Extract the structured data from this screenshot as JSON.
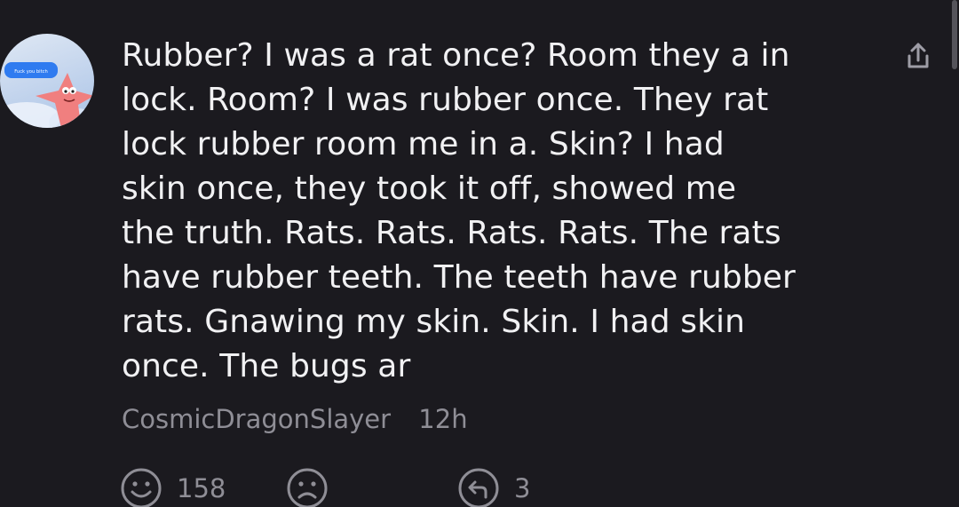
{
  "comment": {
    "avatar_text": "Fuck you bitch",
    "lines": [
      "Rubber? I was a rat once? Room they a in",
      "lock. Room? I was rubber once. They rat",
      "lock rubber room me in a. Skin? I had",
      "skin once, they took it off, showed me",
      "the truth. Rats. Rats. Rats. Rats. The rats",
      "have rubber teeth. The teeth have rubber",
      "rats. Gnawing my skin. Skin. I had skin",
      "once. The bugs ar"
    ],
    "author": "CosmicDragonSlayer",
    "time": "12h"
  },
  "actions": {
    "like_icon": "smiley-face-icon",
    "like_count": "158",
    "dislike_icon": "sad-face-icon",
    "reply_icon": "reply-icon",
    "reply_count": "3",
    "share_icon": "share-icon"
  },
  "colors": {
    "background": "#1b1a1f",
    "text": "#f1f1f3",
    "muted": "#8f8e96"
  }
}
